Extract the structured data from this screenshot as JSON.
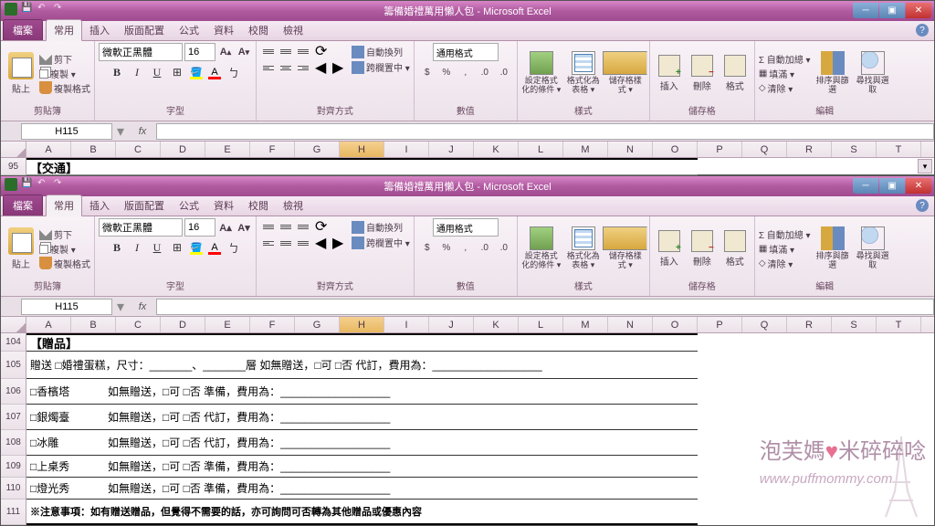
{
  "app_title": "籌備婚禮萬用懶人包 - Microsoft Excel",
  "tabs": {
    "file": "檔案",
    "items": [
      "常用",
      "插入",
      "版面配置",
      "公式",
      "資料",
      "校閱",
      "檢視"
    ],
    "active": 0
  },
  "clipboard": {
    "paste": "貼上",
    "cut": "剪下",
    "copy": "複製 ▾",
    "brush": "複製格式",
    "label": "剪貼簿"
  },
  "font": {
    "name": "微軟正黑體",
    "size": "16",
    "label": "字型"
  },
  "alignment": {
    "wrap": "自動換列",
    "merge": "跨欄置中 ▾",
    "label": "對齊方式"
  },
  "number": {
    "format": "通用格式",
    "label": "數值"
  },
  "styles": {
    "cond": "設定格式化的條件 ▾",
    "table": "格式化為表格 ▾",
    "cell": "儲存格樣式 ▾",
    "label": "樣式"
  },
  "cells": {
    "insert": "插入",
    "delete": "刪除",
    "format": "格式",
    "label": "儲存格"
  },
  "editing": {
    "sum": "Σ 自動加總 ▾",
    "fill": "填滿 ▾",
    "clear": "清除 ▾",
    "sort": "排序與篩選",
    "find": "尋找與選取",
    "label": "編輯"
  },
  "namebox": "H115",
  "columns": [
    "A",
    "B",
    "C",
    "D",
    "E",
    "F",
    "G",
    "H",
    "I",
    "J",
    "K",
    "L",
    "M",
    "N",
    "O",
    "P",
    "Q",
    "R",
    "S",
    "T"
  ],
  "sheet1": {
    "row": "95",
    "title": "【交通】"
  },
  "sheet2": {
    "rows": [
      "104",
      "",
      "105",
      "",
      "106",
      "",
      "107",
      "",
      "108",
      "",
      "109",
      "",
      "110",
      "",
      "111"
    ],
    "row_labels": [
      "104",
      "105",
      "106",
      "107",
      "108",
      "109",
      "110",
      "111"
    ],
    "title": "【贈品】",
    "line1": "贈送 □婚禮蛋糕，尺寸：_______、_______層 如無贈送，□可 □否 代訂，費用為：__________________",
    "items": [
      {
        "name": "□香檳塔",
        "rest": "如無贈送，□可 □否 準備，費用為：__________________"
      },
      {
        "name": "□銀燭臺",
        "rest": "如無贈送，□可 □否 代訂，費用為：__________________"
      },
      {
        "name": "□冰雕",
        "rest": "如無贈送，□可 □否 代訂，費用為：__________________"
      },
      {
        "name": "□上桌秀",
        "rest": "如無贈送，□可 □否 準備，費用為：__________________"
      },
      {
        "name": "□燈光秀",
        "rest": "如無贈送，□可 □否 準備，費用為：__________________"
      }
    ],
    "note": "※注意事項：如有贈送贈品，但覺得不需要的話，亦可詢問可否轉為其他贈品或優惠內容"
  },
  "watermark": {
    "text1": "泡芙媽",
    "text2": "米碎碎唸",
    "url": "www.puffmommy.com"
  }
}
